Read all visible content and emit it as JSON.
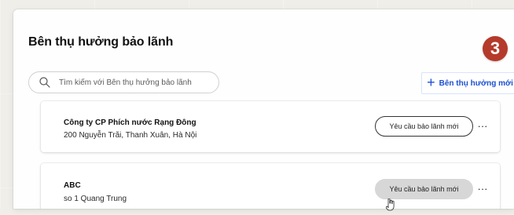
{
  "colors": {
    "background": "#efeee9",
    "panel": "#ffffff",
    "accent": "#1b4fd1",
    "badge": "#b53a2b",
    "text_primary": "#111111",
    "text_secondary": "#2a2a2a",
    "button_hover": "#d7d7d7"
  },
  "page": {
    "title": "Bên thụ hưởng bảo lãnh"
  },
  "search": {
    "placeholder": "Tìm kiếm với Bên thụ hưởng bảo lãnh",
    "value": "",
    "icon": "search-icon"
  },
  "actions": {
    "add_beneficiary_label": "Bên thụ hưởng mới",
    "add_icon": "plus-icon"
  },
  "badge": {
    "step": "3"
  },
  "beneficiaries": [
    {
      "name": "Công ty CP Phích nước Rạng Đông",
      "address": "200 Nguyễn Trãi, Thanh Xuân, Hà Nội",
      "request_label": "Yêu cầu bảo lãnh mới",
      "more_label": "···"
    },
    {
      "name": "ABC",
      "address": "so 1 Quang Trung",
      "request_label": "Yêu cầu bảo lãnh mới",
      "more_label": "···"
    }
  ]
}
